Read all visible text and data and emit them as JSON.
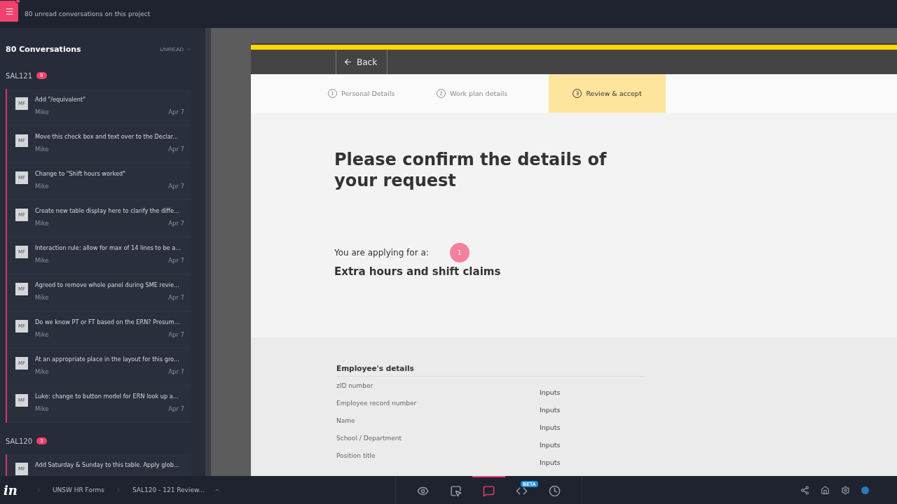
{
  "topbar": {
    "notice": "80 unread conversations on this project",
    "has_unread": true
  },
  "sidebar": {
    "title": "80 Conversations",
    "filter": "UNREAD",
    "groups": [
      {
        "name": "SAL121",
        "count": "9",
        "items": [
          {
            "avatar": "MF",
            "text": "Add \"/equivalent\"",
            "author": "Mike",
            "date": "Apr 7"
          },
          {
            "avatar": "MF",
            "text": "Move this check box and text over to the Declar...",
            "author": "Mike",
            "date": "Apr 7"
          },
          {
            "avatar": "MF",
            "text": "Change to \"Shift hours worked\"",
            "author": "Mike",
            "date": "Apr 7"
          },
          {
            "avatar": "MF",
            "text": "Create new table display here to clarify the diffe...",
            "author": "Mike",
            "date": "Apr 7"
          },
          {
            "avatar": "MF",
            "text": "Interaction rule: allow for max of 14 lines to be a...",
            "author": "Mike",
            "date": "Apr 7"
          },
          {
            "avatar": "MF",
            "text": "Agreed to remove whole panel during SME revie...",
            "author": "Mike",
            "date": "Apr 7"
          },
          {
            "avatar": "MF",
            "text": "Do we know PT or FT based on the ERN? Presum...",
            "author": "Mike",
            "date": "Apr 7"
          },
          {
            "avatar": "MF",
            "text": "At an appropriate place in the layout for this gro...",
            "author": "Mike",
            "date": "Apr 7"
          },
          {
            "avatar": "MF",
            "text": "Luke: change to button model for ERN look up a...",
            "author": "Mike",
            "date": "Apr 7"
          }
        ]
      },
      {
        "name": "SAL120",
        "count": "3",
        "items": [
          {
            "avatar": "MF",
            "text": "Add Saturday & Sunday to this table. Apply glob..."
          }
        ]
      }
    ]
  },
  "screen": {
    "back": "Back",
    "steps": [
      {
        "number": "1",
        "label": "Personal Details",
        "selected": false
      },
      {
        "number": "2",
        "label": "Work plan details",
        "selected": false
      },
      {
        "number": "3",
        "label": "Review & accept",
        "selected": true
      }
    ],
    "heading": "Please confirm the details of your request",
    "applying_label": "You are applying for a:",
    "comment_pin": "1",
    "applying_value": "Extra hours and shift claims",
    "section_title": "Employee's details",
    "fields": [
      {
        "label": "zID number",
        "value": "Inputs"
      },
      {
        "label": "Employee record number",
        "value": "Inputs"
      },
      {
        "label": "Name",
        "value": "Inputs"
      },
      {
        "label": "School / Department",
        "value": "Inputs"
      },
      {
        "label": "Position title",
        "value": "Inputs"
      }
    ]
  },
  "bottombar": {
    "logo": "in",
    "breadcrumbs": [
      "UNSW HR Forms",
      "SAL120 - 121 Review..."
    ],
    "modes": [
      {
        "kind": "preview",
        "selected": false
      },
      {
        "kind": "build",
        "selected": false
      },
      {
        "kind": "comment",
        "selected": true
      },
      {
        "kind": "inspect",
        "selected": false,
        "badge": "BETA"
      },
      {
        "kind": "history",
        "selected": false
      }
    ]
  }
}
